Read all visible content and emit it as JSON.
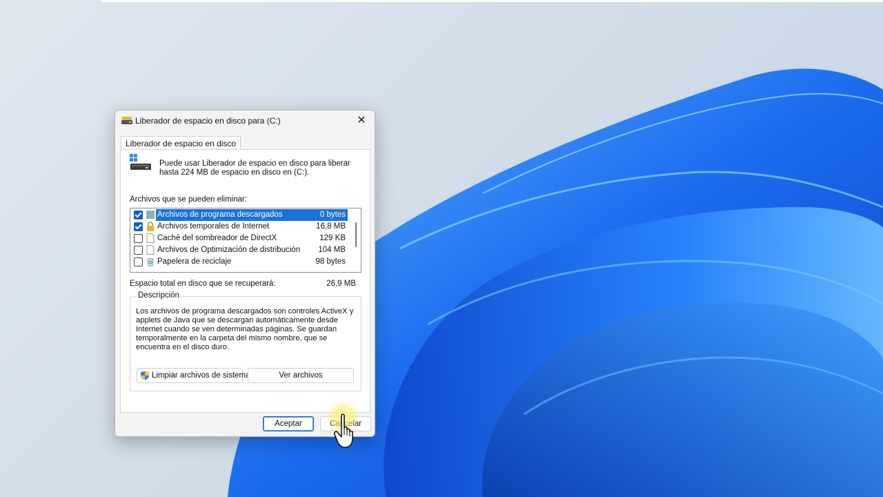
{
  "colors": {
    "selection": "#1a73d9",
    "checkbox_checked": "#1560c0",
    "wallpaper_blue": "#1565e6"
  },
  "dialog": {
    "title": "Liberador de espacio en disco para  (C:)",
    "title_icon": "disk-cleanup-icon",
    "close_icon": "close-icon",
    "close_label": "✕",
    "tab_label": "Liberador de espacio en disco",
    "intro_text": "Puede usar Liberador de espacio en disco para liberar hasta 224 MB de espacio en disco en  (C:).",
    "files_label": "Archivos que se pueden eliminar:",
    "items": [
      {
        "name": "Archivos de programa descargados",
        "size": "0 bytes",
        "checked": true,
        "selected": true,
        "icon": "folder-icon"
      },
      {
        "name": "Archivos temporales de Internet",
        "size": "16,8 MB",
        "checked": true,
        "selected": false,
        "icon": "lock-icon"
      },
      {
        "name": "Caché del sombreador de DirectX",
        "size": "129 KB",
        "checked": false,
        "selected": false,
        "icon": "file-icon"
      },
      {
        "name": "Archivos de Optimización de distribución",
        "size": "104 MB",
        "checked": false,
        "selected": false,
        "icon": "file-icon"
      },
      {
        "name": "Papelera de reciclaje",
        "size": "98 bytes",
        "checked": false,
        "selected": false,
        "icon": "recycle-bin-icon"
      }
    ],
    "total_label": "Espacio total en disco que se recuperará:",
    "total_value": "26,9 MB",
    "description_title": "Descripción",
    "description_text": "Los archivos de programa descargados son controles ActiveX y applets de Java que se descargan automáticamente desde Internet cuando se ven determinadas páginas. Se guardan temporalmente en la carpeta del mismo nombre, que se encuentra en el disco duro.",
    "clean_system_label": "Limpiar archivos de sistema",
    "view_files_label": "Ver archivos",
    "ok_label": "Aceptar",
    "cancel_label": "Cancelar"
  }
}
